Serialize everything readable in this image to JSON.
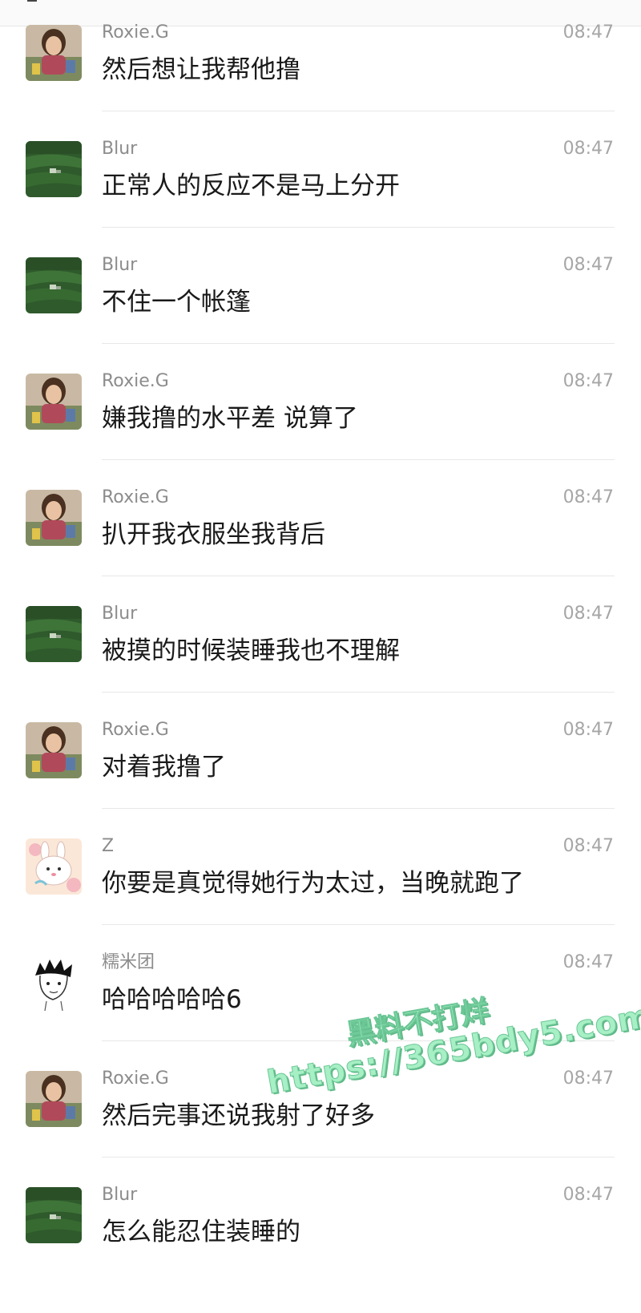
{
  "messages": [
    {
      "sender": "Roxie.G",
      "time": "08:47",
      "text": "然后想让我帮他撸",
      "avatar": "portrait-avatar"
    },
    {
      "sender": "Blur",
      "time": "08:47",
      "text": "正常人的反应不是马上分开",
      "avatar": "grass-field-avatar"
    },
    {
      "sender": "Blur",
      "time": "08:47",
      "text": "不住一个帐篷",
      "avatar": "grass-field-avatar"
    },
    {
      "sender": "Roxie.G",
      "time": "08:47",
      "text": "嫌我撸的水平差 说算了",
      "avatar": "portrait-avatar"
    },
    {
      "sender": "Roxie.G",
      "time": "08:47",
      "text": "扒开我衣服坐我背后",
      "avatar": "portrait-avatar"
    },
    {
      "sender": "Blur",
      "time": "08:47",
      "text": "被摸的时候装睡我也不理解",
      "avatar": "grass-field-avatar"
    },
    {
      "sender": "Roxie.G",
      "time": "08:47",
      "text": "对着我撸了",
      "avatar": "portrait-avatar"
    },
    {
      "sender": "Z",
      "time": "08:47",
      "text": "你要是真觉得她行为太过，当晚就跑了",
      "avatar": "cartoon-bunny-avatar"
    },
    {
      "sender": "糯米团",
      "time": "08:47",
      "text": "哈哈哈哈哈6",
      "avatar": "sketch-boy-avatar"
    },
    {
      "sender": "Roxie.G",
      "time": "08:47",
      "text": "然后完事还说我射了好多",
      "avatar": "portrait-avatar"
    },
    {
      "sender": "Blur",
      "time": "08:47",
      "text": "怎么能忍住装睡的",
      "avatar": "grass-field-avatar"
    }
  ],
  "watermark": {
    "line1": "黑料不打烊",
    "line2": "https://365bdy5.com"
  },
  "colors": {
    "sender": "#8c8c8c",
    "time": "#a6a6a6",
    "text": "#1a1a1a",
    "divider": "#e8e8e8",
    "watermark": "#a7efc5"
  }
}
